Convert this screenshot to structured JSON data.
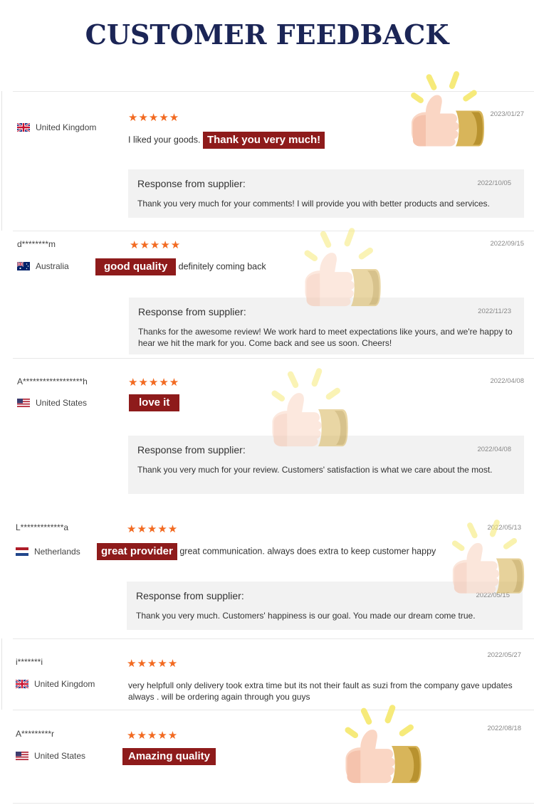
{
  "page": {
    "title": "CUSTOMER FEEDBACK"
  },
  "colors": {
    "title": "#1b2556",
    "star": "#f26a21",
    "tag_bg": "#8e1b1b",
    "response_bg": "#f2f2f2"
  },
  "icons": {
    "star": "★",
    "thumb": "thumbs-up-icon"
  },
  "response_title": "Response from supplier:",
  "reviews": [
    {
      "username": "",
      "country": "United Kingdom",
      "flag": "uk-flag-icon",
      "rating": 5,
      "stars": "★★★★★",
      "date": "2023/01/27",
      "comment_before": "I liked your goods.",
      "tag": "Thank you very much!",
      "comment_after": "",
      "response_date": "2022/10/05",
      "response_text": "Thank you very much for your comments! I will provide you with better products and services."
    },
    {
      "username": "d********m",
      "country": "Australia",
      "flag": "australia-flag-icon",
      "rating": 5,
      "stars": "★★★★★",
      "date": "2022/09/15",
      "comment_before": "",
      "tag": "good quality",
      "comment_after": "definitely coming back",
      "response_date": "2022/11/23",
      "response_text": "Thanks for the awesome review! We work hard to meet expectations like yours, and we're happy to hear we hit the mark for you. Come back and see us soon. Cheers!"
    },
    {
      "username": "A******************h",
      "country": "United States",
      "flag": "us-flag-icon",
      "rating": 5,
      "stars": "★★★★★",
      "date": "2022/04/08",
      "comment_before": "",
      "tag": "love it",
      "comment_after": "",
      "response_date": "2022/04/08",
      "response_text": "Thank you very much for your review. Customers' satisfaction is what we care about the most."
    },
    {
      "username": "L*************a",
      "country": "Netherlands",
      "flag": "netherlands-flag-icon",
      "rating": 5,
      "stars": "★★★★★",
      "date": "2022/05/13",
      "comment_before": "",
      "tag": "great provider",
      "comment_after": "great communication. always does extra to keep customer happy",
      "response_date": "2022/05/15",
      "response_text": "Thank you very much. Customers' happiness is our goal. You made our dream come true."
    },
    {
      "username": "i*******i",
      "country": "United Kingdom",
      "flag": "uk-flag-icon",
      "rating": 5,
      "stars": "★★★★★",
      "date": "2022/05/27",
      "comment_before": "very helpfull only delivery took extra time but its not their fault as suzi from the company gave updates always . will be ordering again through you guys",
      "tag": "",
      "comment_after": ""
    },
    {
      "username": "A*********r",
      "country": "United States",
      "flag": "us-flag-icon",
      "rating": 5,
      "stars": "★★★★★",
      "date": "2022/08/18",
      "comment_before": "",
      "tag": "Amazing quality",
      "comment_after": ""
    }
  ]
}
